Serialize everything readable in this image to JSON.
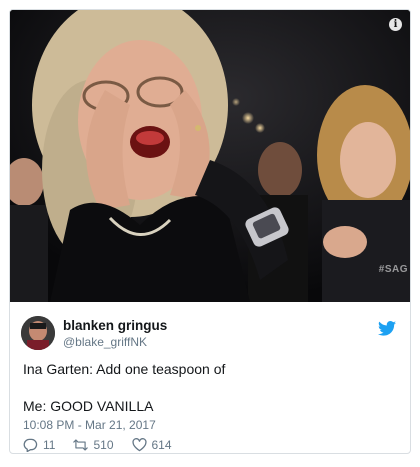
{
  "media": {
    "info_badge": "i",
    "watermark": "#SAG"
  },
  "tweet": {
    "display_name": "blanken gringus",
    "handle": "@blake_griffNK",
    "text_line_1": "Ina Garten: Add one teaspoon of",
    "text_line_2": "Me: GOOD VANILLA",
    "timestamp": "10:08 PM - Mar 21, 2017",
    "actions": {
      "replies": "11",
      "retweets": "510",
      "likes": "614"
    }
  },
  "colors": {
    "twitter_blue": "#1da1f2",
    "secondary_text": "#657786",
    "card_border": "#d9dee2"
  },
  "icons": [
    "info-icon",
    "twitter-bird-icon",
    "reply-icon",
    "retweet-icon",
    "like-icon"
  ]
}
